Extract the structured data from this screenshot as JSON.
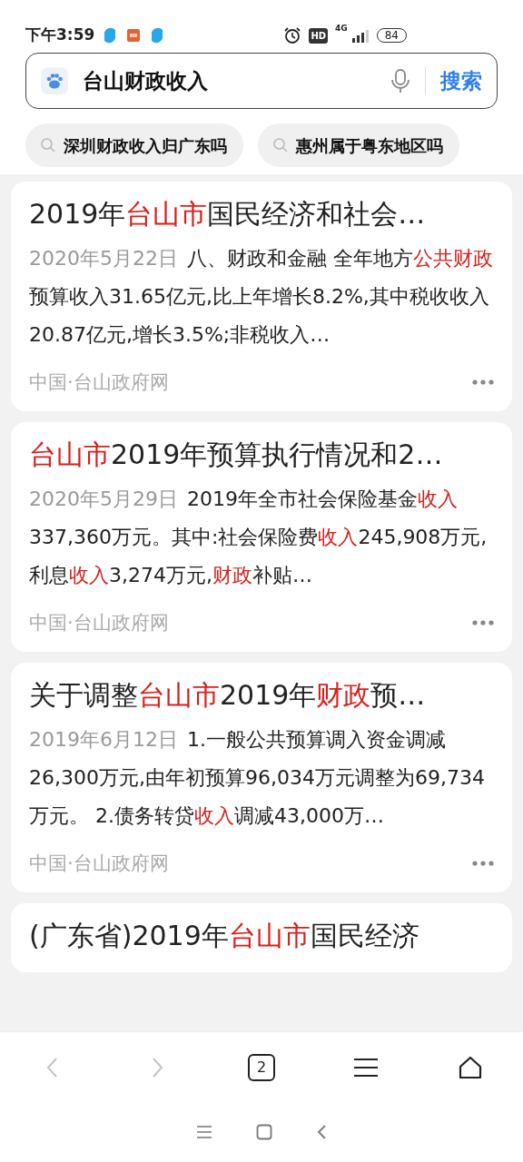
{
  "status_bar": {
    "time": "下午3:59",
    "hd": "HD",
    "network": "4G",
    "battery": "84"
  },
  "search": {
    "value": "台山财政收入",
    "button": "搜索"
  },
  "suggestions": [
    "深圳财政收入归广东吗",
    "惠州属于粤东地区吗"
  ],
  "results": [
    {
      "title": [
        {
          "text": "2019年",
          "highlight": false
        },
        {
          "text": "台山市",
          "highlight": true
        },
        {
          "text": "国民经济和社会…",
          "highlight": false
        }
      ],
      "date": "2020年5月22日",
      "snippet": [
        {
          "text": "八、财政和金融 全年地方",
          "highlight": false
        },
        {
          "text": "公共财政",
          "highlight": true
        },
        {
          "text": "预算收入31.65亿元,比上年增长8.2%,其中税收收入20.87亿元,增长3.5%;非税收入…",
          "highlight": false
        }
      ],
      "source": "中国·台山政府网"
    },
    {
      "title": [
        {
          "text": "台山市",
          "highlight": true
        },
        {
          "text": "2019年预算执行情况和2…",
          "highlight": false
        }
      ],
      "date": "2020年5月29日",
      "snippet": [
        {
          "text": "2019年全市社会保险基金",
          "highlight": false
        },
        {
          "text": "收入",
          "highlight": true
        },
        {
          "text": "337,360万元。其中:社会保险费",
          "highlight": false
        },
        {
          "text": "收入",
          "highlight": true
        },
        {
          "text": "245,908万元,利息",
          "highlight": false
        },
        {
          "text": "收入",
          "highlight": true
        },
        {
          "text": "3,274万元,",
          "highlight": false
        },
        {
          "text": "财政",
          "highlight": true
        },
        {
          "text": "补贴…",
          "highlight": false
        }
      ],
      "source": "中国·台山政府网"
    },
    {
      "title": [
        {
          "text": "关于调整",
          "highlight": false
        },
        {
          "text": "台山市",
          "highlight": true
        },
        {
          "text": "2019年",
          "highlight": false
        },
        {
          "text": "财政",
          "highlight": true
        },
        {
          "text": "预…",
          "highlight": false
        }
      ],
      "date": "2019年6月12日",
      "snippet": [
        {
          "text": "1.一般公共预算调入资金调减26,300万元,由年初预算96,034万元调整为69,734万元。 2.债务转贷",
          "highlight": false
        },
        {
          "text": "收入",
          "highlight": true
        },
        {
          "text": "调减43,000万…",
          "highlight": false
        }
      ],
      "source": "中国·台山政府网"
    },
    {
      "title": [
        {
          "text": "(广东省)2019年",
          "highlight": false
        },
        {
          "text": "台山市",
          "highlight": true
        },
        {
          "text": "国民经济",
          "highlight": false
        }
      ]
    }
  ],
  "toolbar": [
    {
      "kind": "back",
      "disabled": true
    },
    {
      "kind": "forward",
      "disabled": true
    },
    {
      "kind": "tabs",
      "label": "2",
      "disabled": false
    },
    {
      "kind": "menu",
      "disabled": false
    },
    {
      "kind": "home",
      "disabled": false
    }
  ],
  "nav_bar": [
    {
      "kind": "recents"
    },
    {
      "kind": "home"
    },
    {
      "kind": "back"
    }
  ]
}
